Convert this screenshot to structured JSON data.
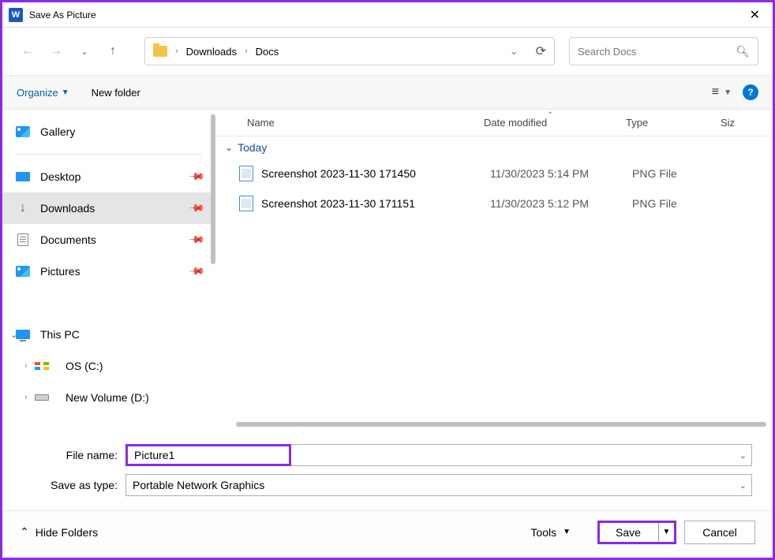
{
  "titlebar": {
    "title": "Save As Picture"
  },
  "breadcrumb": {
    "items": [
      "Downloads",
      "Docs"
    ]
  },
  "search": {
    "placeholder": "Search Docs"
  },
  "toolbar": {
    "organize": "Organize",
    "new_folder": "New folder"
  },
  "sidebar": {
    "gallery": "Gallery",
    "desktop": "Desktop",
    "downloads": "Downloads",
    "documents": "Documents",
    "pictures": "Pictures",
    "this_pc": "This PC",
    "drive_c": "OS (C:)",
    "drive_d": "New Volume (D:)"
  },
  "columns": {
    "name": "Name",
    "date": "Date modified",
    "type": "Type",
    "size": "Siz"
  },
  "group": "Today",
  "files": [
    {
      "name": "Screenshot 2023-11-30 171450",
      "date": "11/30/2023 5:14 PM",
      "type": "PNG File"
    },
    {
      "name": "Screenshot 2023-11-30 171151",
      "date": "11/30/2023 5:12 PM",
      "type": "PNG File"
    }
  ],
  "form": {
    "file_name_label": "File name:",
    "file_name_value": "Picture1",
    "save_as_type_label": "Save as type:",
    "save_as_type_value": "Portable Network Graphics"
  },
  "bottom": {
    "hide_folders": "Hide Folders",
    "tools": "Tools",
    "save": "Save",
    "cancel": "Cancel"
  }
}
